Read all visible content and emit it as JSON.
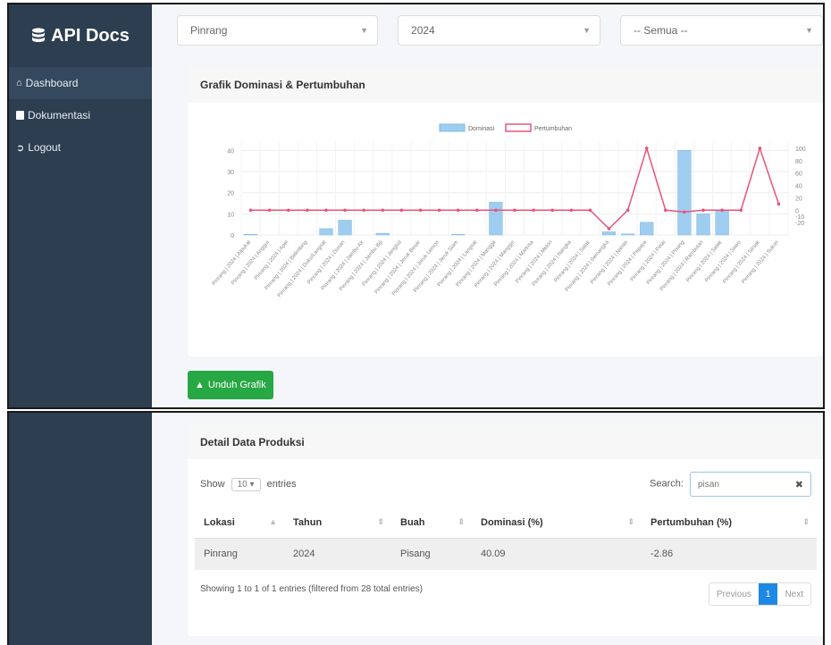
{
  "sidebar": {
    "brand": "API Docs",
    "items": [
      {
        "label": "Dashboard",
        "icon": "home-icon"
      },
      {
        "label": "Dokumentasi",
        "icon": "book-icon"
      },
      {
        "label": "Logout",
        "icon": "logout-icon"
      }
    ]
  },
  "filters": {
    "location": "Pinrang",
    "year": "2024",
    "fruit": "-- Semua --"
  },
  "chart_section": {
    "title": "Grafik Dominasi & Pertumbuhan",
    "download_label": "Unduh Grafik"
  },
  "chart_data": {
    "type": "bar",
    "legend": [
      "Dominasi",
      "Pertumbuhan"
    ],
    "categories": [
      "Pinrang | 2024 | Alpukat",
      "Pinrang | 2024 | Anggur",
      "Pinrang | 2024 | Apel",
      "Pinrang | 2024 | Belimbing",
      "Pinrang | 2024 | Duku/Langsat",
      "Pinrang | 2024 | Durian",
      "Pinrang | 2024 | Jambu Air",
      "Pinrang | 2024 | Jambu Biji",
      "Pinrang | 2024 | Jengkol",
      "Pinrang | 2024 | Jeruk Besar",
      "Pinrang | 2024 | Jeruk Lemon",
      "Pinrang | 2024 | Jeruk Siam",
      "Pinrang | 2024 | Langsat",
      "Pinrang | 2024 | Mangga",
      "Pinrang | 2024 | Manggis",
      "Pinrang | 2024 | Markisa",
      "Pinrang | 2024 | Melon",
      "Pinrang | 2024 | Nangka",
      "Pinrang | 2024 | Salak",
      "Pinrang | 2024 | Semangka",
      "Pinrang | 2024 | Nanas",
      "Pinrang | 2024 | Pepaya",
      "Pinrang | 2024 | Petai",
      "Pinrang | 2024 | Pisang",
      "Pinrang | 2024 | Rambutan",
      "Pinrang | 2024 | Salak",
      "Pinrang | 2024 | Sawo",
      "Pinrang | 2024 | Sirsak",
      "Pinrang | 2024 | Sukun"
    ],
    "series": [
      {
        "name": "Dominasi",
        "axis": "left",
        "values": [
          0.3,
          0,
          0,
          0,
          3,
          7,
          0,
          0.8,
          0,
          0,
          0,
          0.3,
          0,
          15.5,
          0,
          0,
          0,
          0,
          0,
          1.5,
          0.5,
          6,
          0,
          40.09,
          10,
          11.5,
          0,
          0,
          0
        ]
      },
      {
        "name": "Pertumbuhan",
        "axis": "right",
        "values": [
          0,
          0,
          0,
          0,
          0,
          0,
          0,
          0,
          0,
          0,
          0,
          0,
          0,
          0,
          0,
          0,
          0,
          0,
          0,
          -30,
          0,
          100,
          0,
          -2.86,
          0,
          0,
          0,
          100,
          10
        ]
      }
    ],
    "y_left": {
      "ticks": [
        0,
        10,
        20,
        30,
        40
      ],
      "range": [
        0,
        44
      ]
    },
    "y_right": {
      "ticks": [
        -20,
        -10,
        0,
        20,
        40,
        60,
        80,
        100
      ],
      "range": [
        -40,
        110
      ]
    },
    "colors": {
      "bar": "#9fcdf0",
      "bar_stroke": "#7db8e8",
      "line": "#e8537a"
    },
    "legend_position": "top"
  },
  "detail": {
    "title": "Detail Data Produksi",
    "show_label": "Show",
    "entries_value": "10",
    "entries_label": "entries",
    "search_label": "Search:",
    "search_value": "pisan",
    "columns": [
      "Lokasi",
      "Tahun",
      "Buah",
      "Dominasi (%)",
      "Pertumbuhan (%)"
    ],
    "rows": [
      [
        "Pinrang",
        "2024",
        "Pisang",
        "40.09",
        "-2.86"
      ]
    ],
    "info": "Showing 1 to 1 of 1 entries (filtered from 28 total entries)",
    "pager": {
      "previous": "Previous",
      "current": "1",
      "next": "Next"
    }
  }
}
